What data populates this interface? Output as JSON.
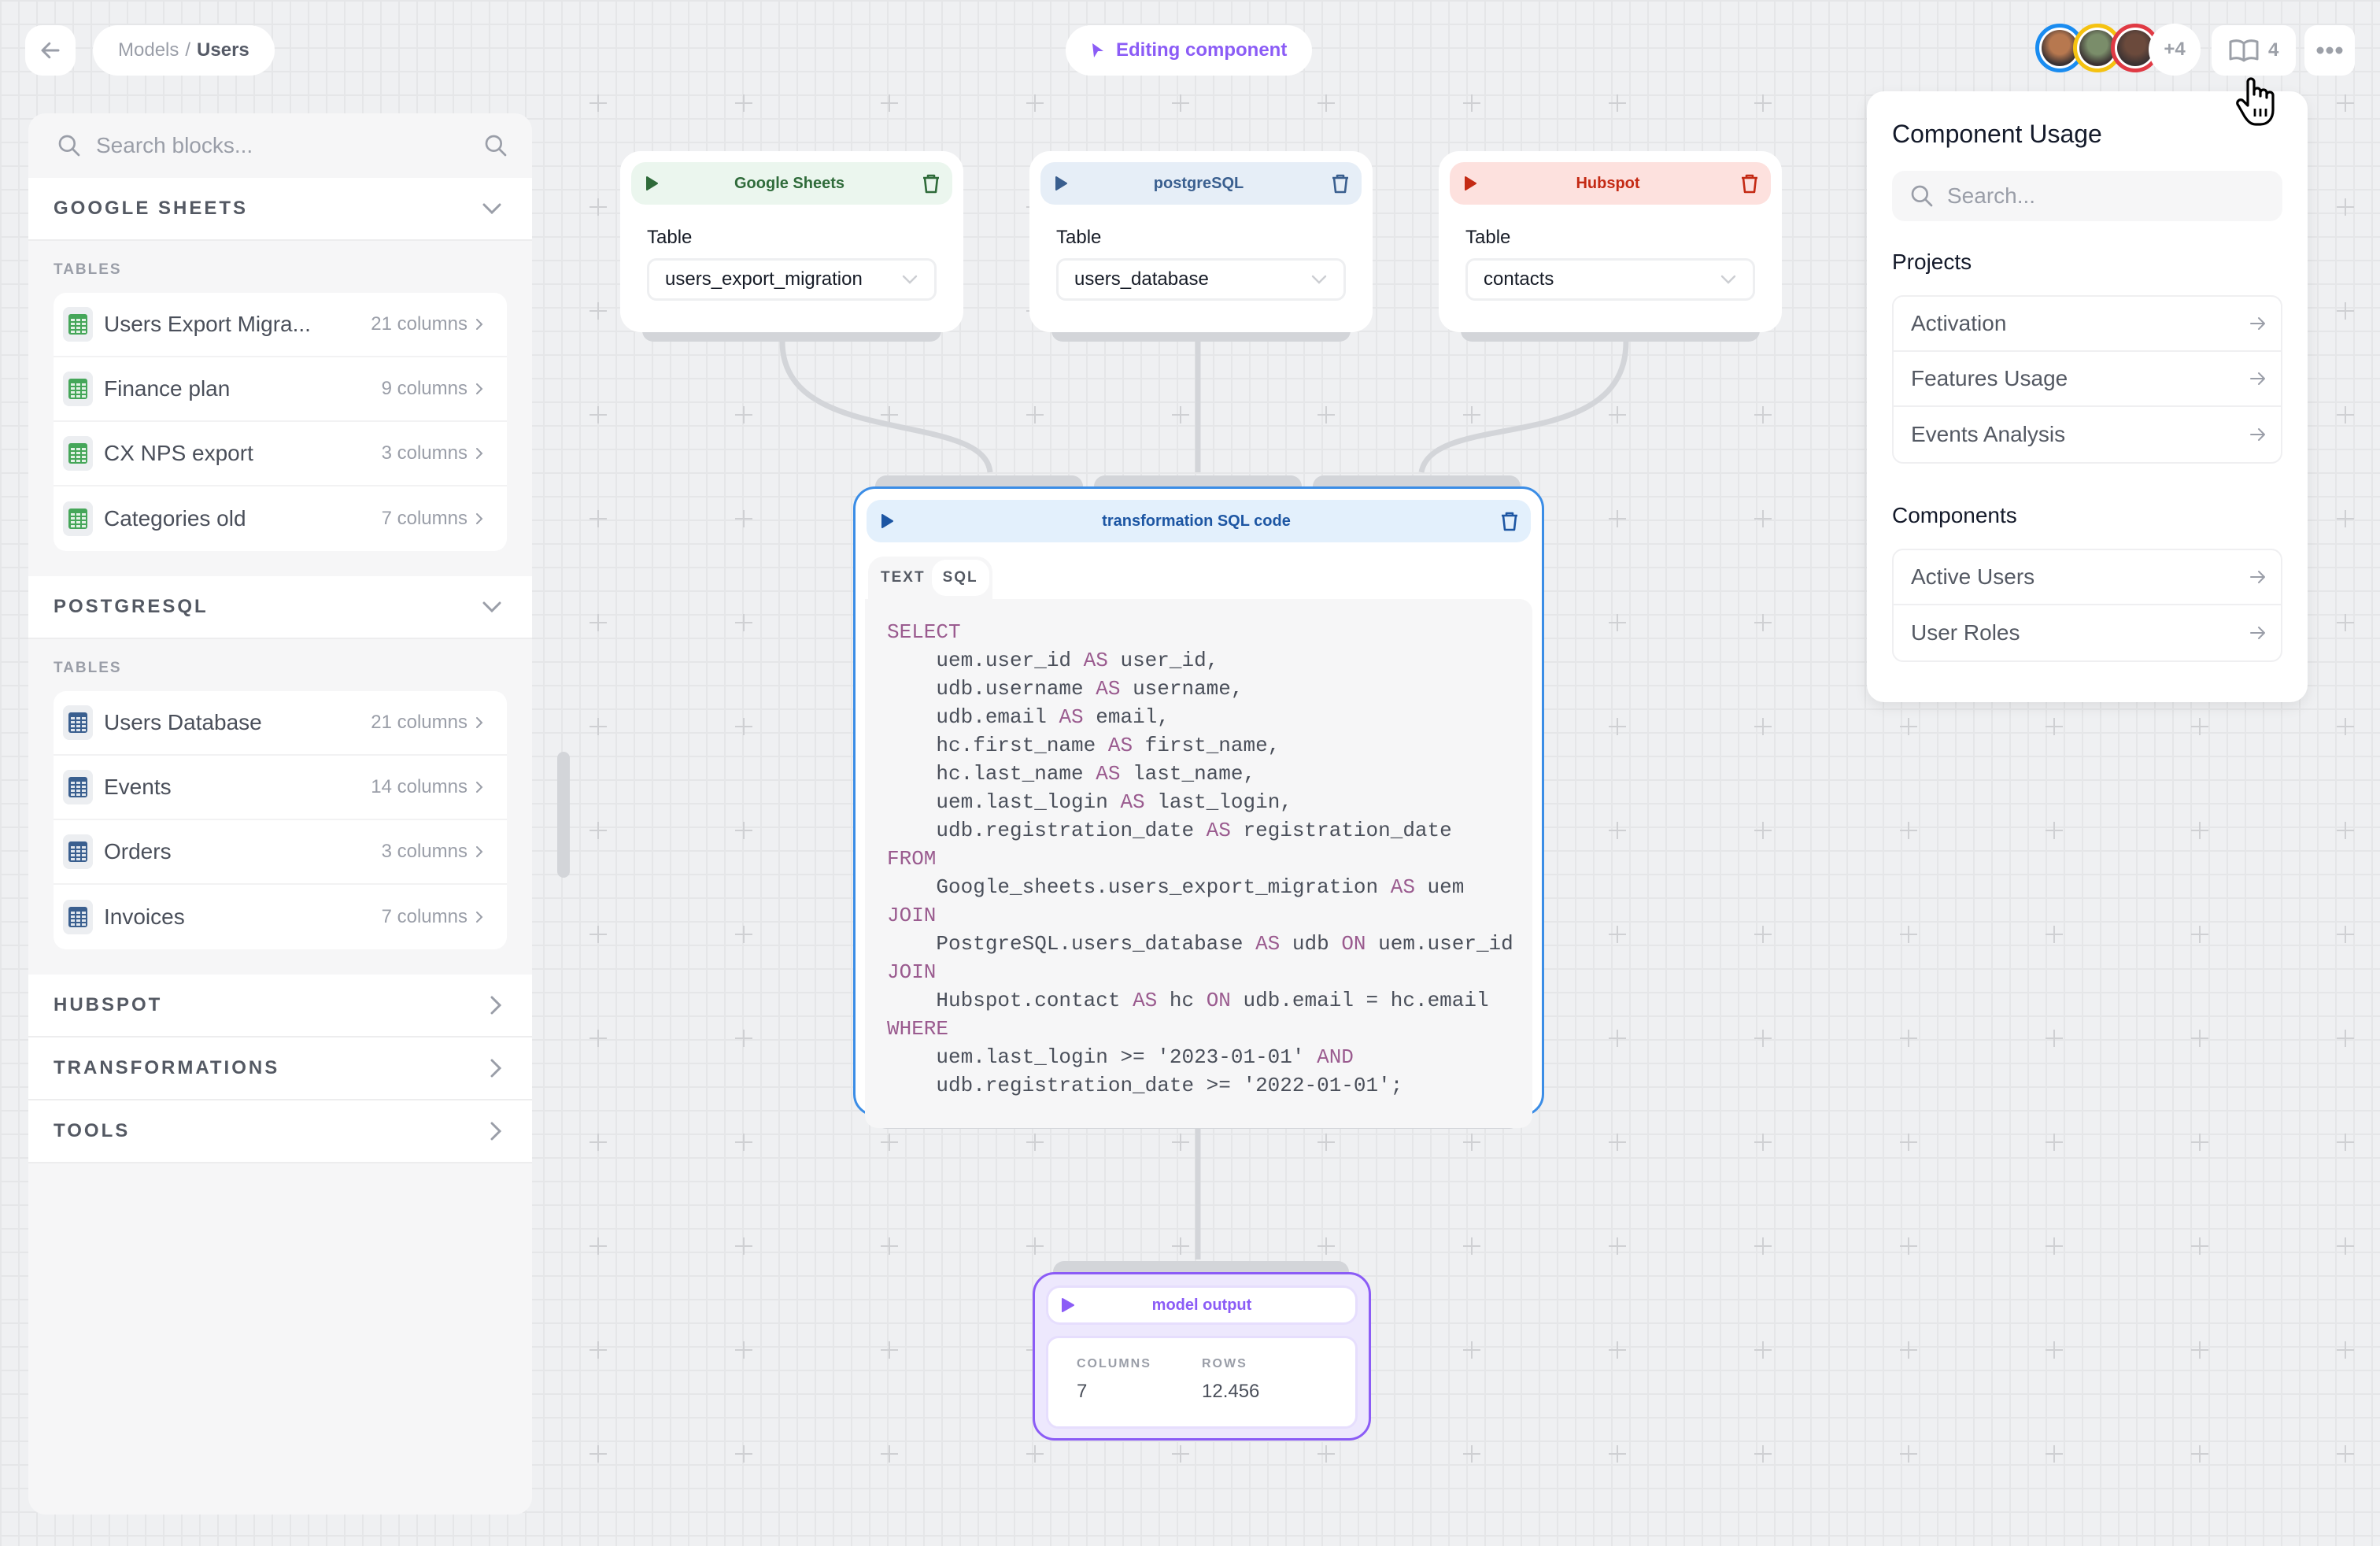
{
  "header": {
    "breadcrumb": {
      "parent": "Models",
      "separator": "/",
      "current": "Users"
    },
    "status_label": "Editing component",
    "collaborators": [
      {
        "ring_color": "#1a8cf0",
        "face_color": "#b7784f"
      },
      {
        "ring_color": "#f5c211",
        "face_color": "#7a8d6a"
      },
      {
        "ring_color": "#e03a44",
        "face_color": "#6b4a3c"
      }
    ],
    "collaborators_more": "+4",
    "docs_count": "4"
  },
  "sidebar": {
    "search_placeholder": "Search blocks...",
    "sections": [
      {
        "title": "GOOGLE SHEETS",
        "expanded": true,
        "group_label": "TABLES",
        "icon_color": "#45a659",
        "items": [
          {
            "name": "Users Export Migra...",
            "columns": "21 columns"
          },
          {
            "name": "Finance plan",
            "columns": "9 columns"
          },
          {
            "name": "CX NPS export",
            "columns": "3 columns"
          },
          {
            "name": "Categories old",
            "columns": "7 columns"
          }
        ]
      },
      {
        "title": "POSTGRESQL",
        "expanded": true,
        "group_label": "TABLES",
        "icon_color": "#3a5f8f",
        "items": [
          {
            "name": "Users Database",
            "columns": "21 columns"
          },
          {
            "name": "Events",
            "columns": "14 columns"
          },
          {
            "name": "Orders",
            "columns": "3 columns"
          },
          {
            "name": "Invoices",
            "columns": "7 columns"
          }
        ]
      },
      {
        "title": "HUBSPOT",
        "expanded": false
      },
      {
        "title": "TRANSFORMATIONS",
        "expanded": false
      },
      {
        "title": "TOOLS",
        "expanded": false
      }
    ]
  },
  "sources": [
    {
      "title": "Google Sheets",
      "field_label": "Table",
      "value": "users_export_migration",
      "head_bg": "#ebf6ee",
      "color": "#2f6b3a"
    },
    {
      "title": "postgreSQL",
      "field_label": "Table",
      "value": "users_database",
      "head_bg": "#e6eef7",
      "color": "#3a5f8f"
    },
    {
      "title": "Hubspot",
      "field_label": "Table",
      "value": "contacts",
      "head_bg": "#fde1de",
      "color": "#c42a14"
    }
  ],
  "transformation": {
    "title": "transformation SQL code",
    "tabs": [
      "TEXT",
      "SQL"
    ],
    "active_tab": "SQL",
    "code_lines": [
      [
        [
          "kw",
          "SELECT"
        ]
      ],
      [
        [
          "t",
          "    uem.user_id "
        ],
        [
          "kw",
          "AS"
        ],
        [
          "t",
          " user_id,"
        ]
      ],
      [
        [
          "t",
          "    udb.username "
        ],
        [
          "kw",
          "AS"
        ],
        [
          "t",
          " username,"
        ]
      ],
      [
        [
          "t",
          "    udb.email "
        ],
        [
          "kw",
          "AS"
        ],
        [
          "t",
          " email,"
        ]
      ],
      [
        [
          "t",
          "    hc.first_name "
        ],
        [
          "kw",
          "AS"
        ],
        [
          "t",
          " first_name,"
        ]
      ],
      [
        [
          "t",
          "    hc.last_name "
        ],
        [
          "kw",
          "AS"
        ],
        [
          "t",
          " last_name,"
        ]
      ],
      [
        [
          "t",
          "    uem.last_login "
        ],
        [
          "kw",
          "AS"
        ],
        [
          "t",
          " last_login,"
        ]
      ],
      [
        [
          "t",
          "    udb.registration_date "
        ],
        [
          "kw",
          "AS"
        ],
        [
          "t",
          " registration_date"
        ]
      ],
      [
        [
          "kw",
          "FROM"
        ]
      ],
      [
        [
          "t",
          "    Google_sheets.users_export_migration "
        ],
        [
          "kw",
          "AS"
        ],
        [
          "t",
          " uem"
        ]
      ],
      [
        [
          "kw",
          "JOIN"
        ]
      ],
      [
        [
          "t",
          "    PostgreSQL.users_database "
        ],
        [
          "kw",
          "AS"
        ],
        [
          "t",
          " udb "
        ],
        [
          "kw",
          "ON"
        ],
        [
          "t",
          " uem.user_id"
        ]
      ],
      [
        [
          "kw",
          "JOIN"
        ]
      ],
      [
        [
          "t",
          "    Hubspot.contact "
        ],
        [
          "kw",
          "AS"
        ],
        [
          "t",
          " hc "
        ],
        [
          "kw",
          "ON"
        ],
        [
          "t",
          " udb.email = hc.email"
        ]
      ],
      [
        [
          "kw",
          "WHERE"
        ]
      ],
      [
        [
          "t",
          "    uem.last_login >= '2023-01-01' "
        ],
        [
          "kw",
          "AND"
        ]
      ],
      [
        [
          "t",
          "    udb.registration_date >= '2022-01-01';"
        ]
      ]
    ]
  },
  "output": {
    "title": "model output",
    "columns_label": "COLUMNS",
    "columns_value": "7",
    "rows_label": "ROWS",
    "rows_value": "12.456"
  },
  "usage_panel": {
    "title": "Component Usage",
    "search_placeholder": "Search...",
    "projects_label": "Projects",
    "projects": [
      "Activation",
      "Features Usage",
      "Events Analysis"
    ],
    "components_label": "Components",
    "components": [
      "Active Users",
      "User Roles"
    ]
  }
}
